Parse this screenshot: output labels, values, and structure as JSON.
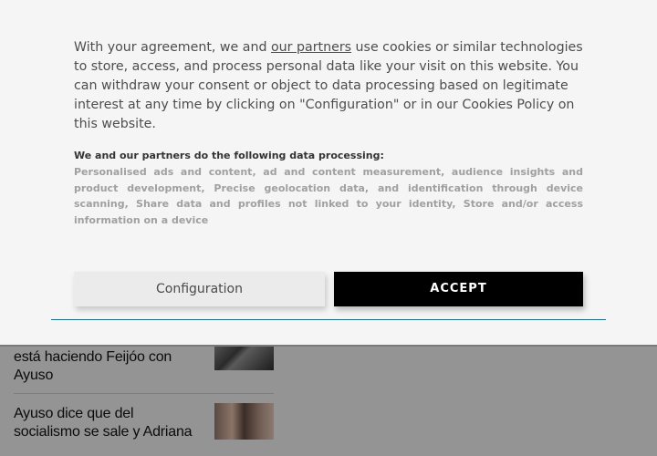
{
  "consent": {
    "intro_before_link": "With your agreement, we and ",
    "partners_link": "our partners",
    "intro_after_link": " use cookies or similar technologies to store, access, and process personal data like your visit on this website. You can withdraw your consent or object to data processing based on legitimate interest at any time by clicking on \"Configuration\" or in our Cookies Policy on this website.",
    "processing_title": "We and our partners do the following data processing:",
    "processing_list": "Personalised ads and content, ad and content measurement, audience insights and product development, Precise geolocation data, and identification through device scanning, Share data and profiles not linked to your identity, Store and/or access information on a device",
    "configuration_label": "Configuration",
    "accept_label": "ACCEPT"
  },
  "news": {
    "items": [
      {
        "headline_line1": "está haciendo Feijóo con",
        "headline_line2": "Ayuso"
      },
      {
        "headline_line1": "Ayuso dice que del",
        "headline_line2": "socialismo se sale y Adriana"
      }
    ]
  },
  "colors": {
    "overlay": "#949494",
    "dialog_bg": "#f5f5f5",
    "accept_bg": "#000000",
    "config_bg": "#ebebeb",
    "accent_rule": "#1f6e86"
  }
}
